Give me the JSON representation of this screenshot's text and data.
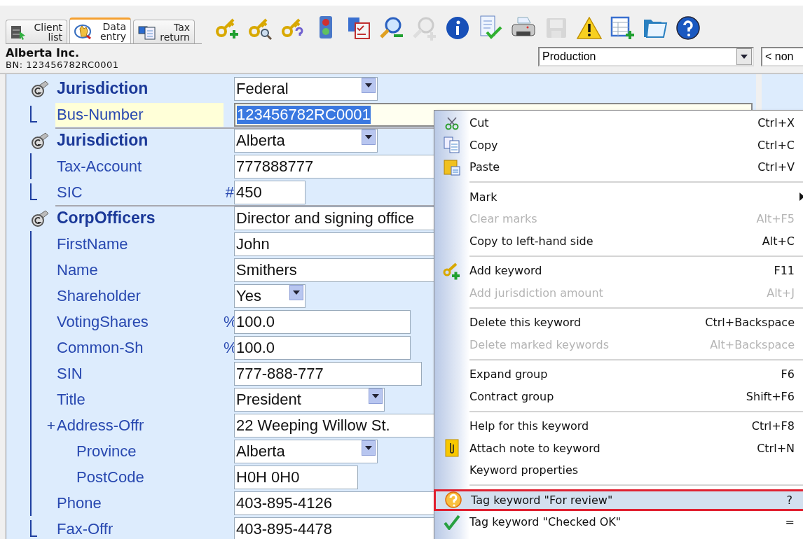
{
  "tabs": [
    {
      "lines": [
        "Client",
        "list"
      ],
      "kind": "client",
      "selected": false
    },
    {
      "lines": [
        "Data",
        "entry"
      ],
      "kind": "entry",
      "selected": true
    },
    {
      "lines": [
        "Tax",
        "return"
      ],
      "kind": "return",
      "selected": false
    }
  ],
  "toolbar": [
    {
      "kind": "key-add",
      "disabled": false
    },
    {
      "kind": "key-search",
      "disabled": false
    },
    {
      "kind": "key-help",
      "disabled": false
    },
    {
      "kind": "traffic",
      "disabled": false
    },
    {
      "kind": "checklist",
      "disabled": false
    },
    {
      "kind": "zoom-out",
      "disabled": false
    },
    {
      "kind": "zoom-in",
      "disabled": true
    },
    {
      "kind": "info",
      "disabled": false
    },
    {
      "kind": "doc-check",
      "disabled": false
    },
    {
      "kind": "printer",
      "disabled": false
    },
    {
      "kind": "save",
      "disabled": true
    },
    {
      "kind": "warning",
      "disabled": false
    },
    {
      "kind": "table-add",
      "disabled": false
    },
    {
      "kind": "folder",
      "disabled": false
    },
    {
      "kind": "help",
      "disabled": false
    }
  ],
  "client": {
    "name": "Alberta Inc.",
    "bn": "BN: 123456782RC0001"
  },
  "selectors": [
    {
      "value": "Production"
    },
    {
      "value": "< non"
    }
  ],
  "form": [
    {
      "label": "Jurisdiction",
      "value": "Federal",
      "kind": "select",
      "children": [
        {
          "label": "Bus-Number",
          "value": "123456782RC0001",
          "kind": "text",
          "selected": true
        }
      ]
    },
    {
      "label": "Jurisdiction",
      "value": "Alberta",
      "kind": "select",
      "children": [
        {
          "label": "Tax-Account",
          "value": "777888777",
          "kind": "text",
          "selected": false
        },
        {
          "label": "SIC",
          "prefix": "#",
          "value": "450",
          "kind": "text",
          "selected": false
        }
      ]
    },
    {
      "label": "CorpOfficers",
      "value": "Director and signing office",
      "kind": "text",
      "children": [
        {
          "label": "FirstName",
          "value": "John",
          "kind": "text",
          "selected": false
        },
        {
          "label": "Name",
          "value": "Smithers",
          "kind": "text",
          "selected": false
        },
        {
          "label": "Shareholder",
          "value": "Yes",
          "kind": "select",
          "selected": false
        },
        {
          "label": "VotingShares",
          "prefix": "%",
          "value": "100.0",
          "kind": "text",
          "selected": false
        },
        {
          "label": "Common-Sh",
          "prefix": "%",
          "value": "100.0",
          "kind": "text",
          "selected": false
        },
        {
          "label": "SIN",
          "value": "777-888-777",
          "kind": "text",
          "selected": false
        },
        {
          "label": "Title",
          "value": "President",
          "kind": "select",
          "selected": false
        },
        {
          "label": "Address-Offr",
          "expander": "+",
          "value": "22 Weeping Willow St.",
          "kind": "text",
          "selected": false,
          "children": [
            {
              "label": "Province",
              "value": "Alberta",
              "kind": "select",
              "selected": false
            },
            {
              "label": "PostCode",
              "value": "H0H 0H0",
              "kind": "text",
              "selected": false
            }
          ]
        },
        {
          "label": "Phone",
          "value": "403-895-4126",
          "kind": "text",
          "selected": false
        },
        {
          "label": "Fax-Offr",
          "value": "403-895-4478",
          "kind": "text",
          "selected": false
        }
      ]
    }
  ],
  "menu": [
    {
      "kind": "item",
      "label": "Cut",
      "shortcut": "Ctrl+X",
      "disabled": false,
      "selected": false
    },
    {
      "kind": "item",
      "label": "Copy",
      "shortcut": "Ctrl+C",
      "disabled": false,
      "selected": false
    },
    {
      "kind": "item",
      "label": "Paste",
      "shortcut": "Ctrl+V",
      "disabled": false,
      "selected": false
    },
    {
      "kind": "separator"
    },
    {
      "kind": "submenu",
      "label": "Mark",
      "disabled": false,
      "selected": false
    },
    {
      "kind": "item",
      "label": "Clear marks",
      "shortcut": "Alt+F5",
      "disabled": true,
      "selected": false
    },
    {
      "kind": "item",
      "label": "Copy to left-hand side",
      "shortcut": "Alt+C",
      "disabled": false,
      "selected": false
    },
    {
      "kind": "separator"
    },
    {
      "kind": "item",
      "label": "Add keyword",
      "shortcut": "F11",
      "disabled": false,
      "selected": false
    },
    {
      "kind": "item",
      "label": "Add jurisdiction amount",
      "shortcut": "Alt+J",
      "disabled": true,
      "selected": false
    },
    {
      "kind": "separator"
    },
    {
      "kind": "item",
      "label": "Delete this keyword",
      "shortcut": "Ctrl+Backspace",
      "disabled": false,
      "selected": false
    },
    {
      "kind": "item",
      "label": "Delete marked keywords",
      "shortcut": "Alt+Backspace",
      "disabled": true,
      "selected": false
    },
    {
      "kind": "separator"
    },
    {
      "kind": "item",
      "label": "Expand group",
      "shortcut": "F6",
      "disabled": false,
      "selected": false
    },
    {
      "kind": "item",
      "label": "Contract group",
      "shortcut": "Shift+F6",
      "disabled": false,
      "selected": false
    },
    {
      "kind": "separator"
    },
    {
      "kind": "item",
      "label": "Help for this keyword",
      "shortcut": "Ctrl+F8",
      "disabled": false,
      "selected": false
    },
    {
      "kind": "item",
      "label": "Attach note to keyword",
      "shortcut": "Ctrl+N",
      "disabled": false,
      "selected": false
    },
    {
      "kind": "item",
      "label": "Keyword properties",
      "disabled": false,
      "selected": false
    },
    {
      "kind": "separator"
    },
    {
      "kind": "item",
      "label": "Tag keyword \"For review\"",
      "shortcut": "?",
      "disabled": false,
      "selected": true
    },
    {
      "kind": "item",
      "label": "Tag keyword \"Checked OK\"",
      "shortcut": "=",
      "disabled": false,
      "selected": false
    }
  ]
}
